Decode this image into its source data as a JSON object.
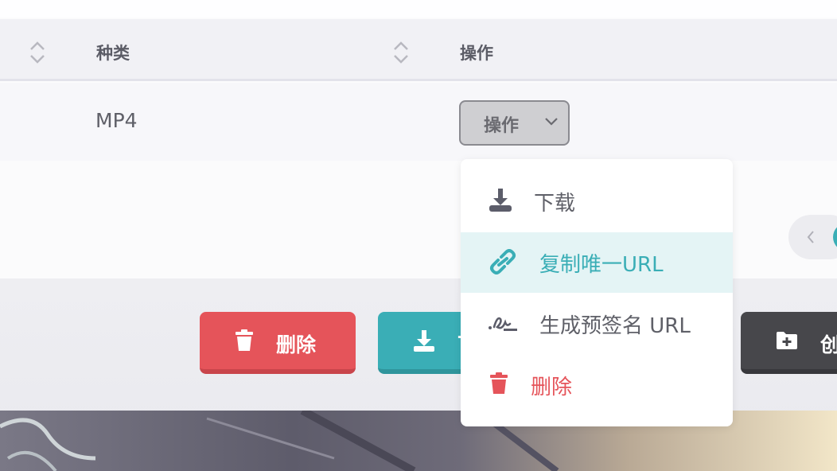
{
  "table": {
    "headers": {
      "kind": "种类",
      "actions": "操作"
    },
    "row": {
      "kind": "MP4",
      "action_button_label": "操作"
    }
  },
  "dropdown": {
    "items": [
      {
        "label": "下载",
        "icon": "download-tray-icon",
        "active": false
      },
      {
        "label": "复制唯一URL",
        "icon": "link-icon",
        "active": true
      },
      {
        "label": "生成预签名 URL",
        "icon": "signature-icon",
        "active": false
      },
      {
        "label": "删除",
        "icon": "trash-icon",
        "active": false
      }
    ]
  },
  "buttons": {
    "delete_label": "删除",
    "download_label": "下",
    "create_label": "创"
  },
  "colors": {
    "teal": "#3aaeb6",
    "danger": "#e5545a",
    "dark": "#47474b",
    "active_bg": "#e4f4f5"
  }
}
